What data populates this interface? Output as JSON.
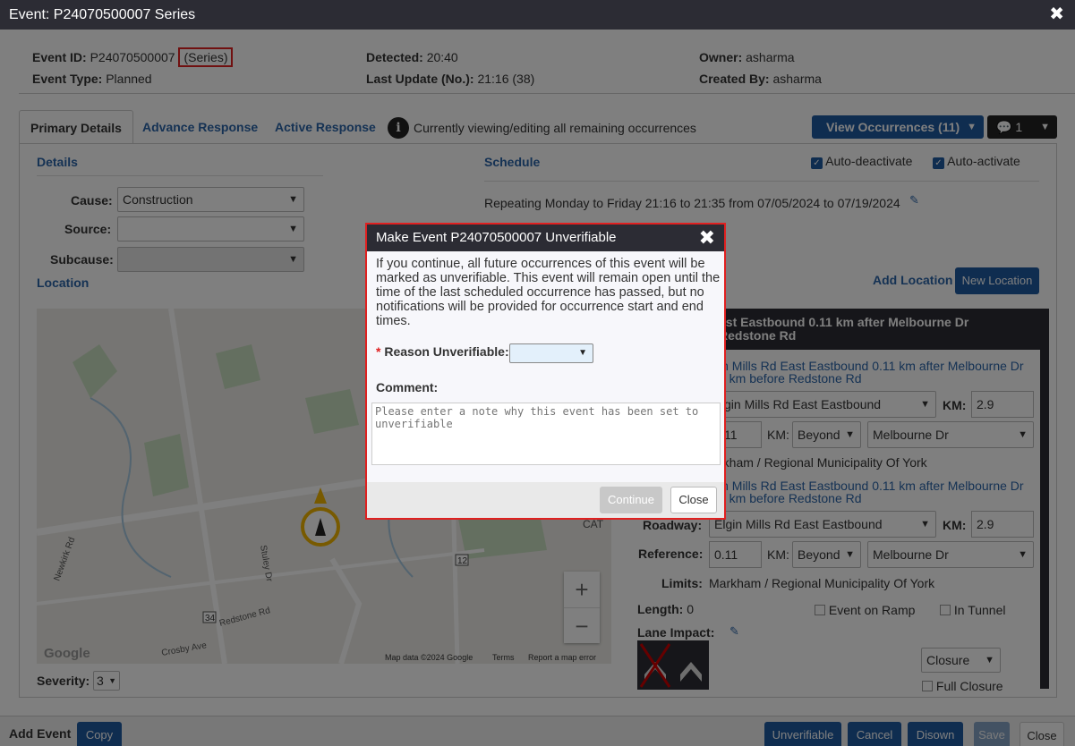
{
  "window": {
    "title": "Event: P24070500007 Series",
    "close_glyph": "✖"
  },
  "summary": {
    "event_id_label": "Event ID:",
    "event_id": "P24070500007",
    "series_tag": "(Series)",
    "event_type_label": "Event Type:",
    "event_type": "Planned",
    "detected_label": "Detected:",
    "detected": "20:40",
    "last_update_label": "Last Update (No.):",
    "last_update": "21:16 (38)",
    "owner_label": "Owner:",
    "owner": "asharma",
    "created_by_label": "Created By:",
    "created_by": "asharma"
  },
  "tabs": [
    "Primary Details",
    "Advance Response",
    "Active Response"
  ],
  "viewing_note": "Currently viewing/editing all remaining occurrences",
  "view_occurrences_label": "View Occurrences (11)",
  "comments_count": "1",
  "details": {
    "heading": "Details",
    "cause_label": "Cause:",
    "cause_value": "Construction",
    "source_label": "Source:",
    "source_value": "",
    "subcause_label": "Subcause:",
    "subcause_value": ""
  },
  "location_heading": "Location",
  "schedule": {
    "heading": "Schedule",
    "auto_deactivate": "Auto-deactivate",
    "auto_activate": "Auto-activate",
    "repeating_text": "Repeating Monday to Friday 21:16 to 21:35 from 07/05/2024 to 07/19/2024"
  },
  "add_location_label": "Add Location",
  "new_location_label": "New Location",
  "location_panel": {
    "header_line1": "ast Eastbound 0.11 km after Melbourne Dr",
    "header_line2": "Redstone Rd",
    "desc1_line1": "in Mills Rd East Eastbound 0.11 km after Melbourne Dr",
    "desc1_line2": "3 km before Redstone Rd",
    "roadway1_value": "gin Mills Rd East Eastbound",
    "km_label": "KM:",
    "km_value": "2.9",
    "ref1_value": "11",
    "beyond": "Beyond",
    "melbourne": "Melbourne Dr",
    "limits1_value": "rkham / Regional Municipality Of York",
    "desc2_line1": "in Mills Rd East Eastbound 0.11 km after Melbourne Dr",
    "desc2_line2": "3 km before Redstone Rd",
    "roadway_label": "Roadway:",
    "roadway2_value": "Elgin Mills Rd East Eastbound",
    "reference_label": "Reference:",
    "ref2_value": "0.11",
    "limits_label": "Limits:",
    "limits2_value": "Markham / Regional Municipality Of York",
    "length_label": "Length:",
    "length_value": "0",
    "event_on_ramp": "Event on Ramp",
    "in_tunnel": "In Tunnel",
    "lane_impact_label": "Lane Impact:",
    "closure_value": "Closure",
    "full_closure": "Full Closure"
  },
  "map": {
    "labels": [
      "Newkirk Rd",
      "Stuley Dr",
      "Redstone Rd",
      "Crosby Ave",
      "12",
      "34",
      "CAT"
    ],
    "attribution": "Map data ©2024 Google",
    "terms": "Terms",
    "report": "Report a map error",
    "google": "Google",
    "zoom_in": "+",
    "zoom_out": "−"
  },
  "severity_label": "Severity:",
  "severity_value": "3",
  "footer": {
    "add_event": "Add Event",
    "copy": "Copy",
    "unverifiable": "Unverifiable",
    "cancel": "Cancel",
    "disown": "Disown",
    "save": "Save",
    "close": "Close"
  },
  "modal": {
    "title": "Make Event P24070500007 Unverifiable",
    "close_glyph": "✖",
    "message": "If you continue, all future occurrences of this event will be marked as unverifiable. This event will remain open until the time of the last scheduled occurrence has passed, but no notifications will be provided for occurrence start and end times.",
    "required_mark": "*",
    "reason_label": "Reason Unverifiable:",
    "reason_value": "",
    "comment_label": "Comment:",
    "comment_placeholder": "Please enter a note why this event has been set to unverifiable",
    "continue_label": "Continue",
    "close_label": "Close"
  },
  "colors": {
    "accent": "#1f5aa0",
    "titlebar": "#2c2c34",
    "highlight": "#e02020"
  }
}
